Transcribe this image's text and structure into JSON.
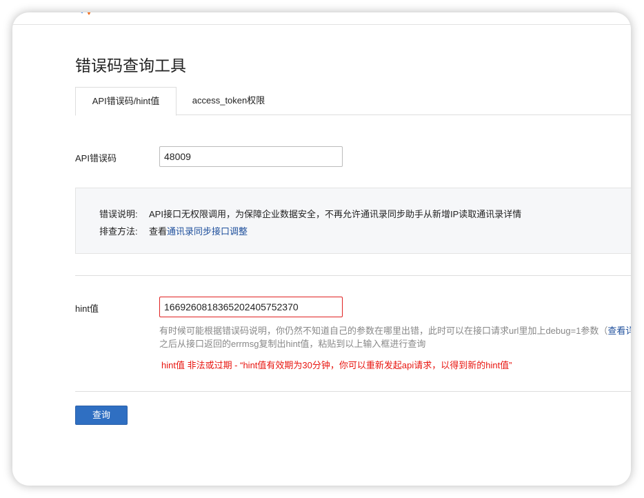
{
  "page_title": "错误码查询工具",
  "tabs": [
    {
      "label": "API错误码/hint值",
      "active": true
    },
    {
      "label": "access_token权限",
      "active": false
    }
  ],
  "api_code": {
    "label": "API错误码",
    "value": "48009"
  },
  "info": {
    "desc_label": "错误说明:",
    "desc_text": "API接口无权限调用，为保障企业数据安全，不再允许通讯录同步助手从新增IP读取通讯录详情",
    "fix_label": "排查方法:",
    "fix_prefix": "查看",
    "fix_link": "通讯录同步接口调整"
  },
  "hint": {
    "label": "hint值",
    "value": "1669260818365202405752370",
    "help_line1": "有时候可能根据错误码说明，你仍然不知道自己的参数在哪里出错，此时可以在接口请求url里加上debug=1参数（",
    "help_link": "查看详",
    "help_line2": "之后从接口返回的errmsg复制出hint值，粘贴到以上输入框进行查询",
    "error": "hint值 非法或过期 - “hint值有效期为30分钟，你可以重新发起api请求，以得到新的hint值”"
  },
  "query_button": "查询",
  "colors": {
    "primary": "#2f6fc2",
    "error": "#e8150f",
    "link": "#1e4f9c"
  }
}
